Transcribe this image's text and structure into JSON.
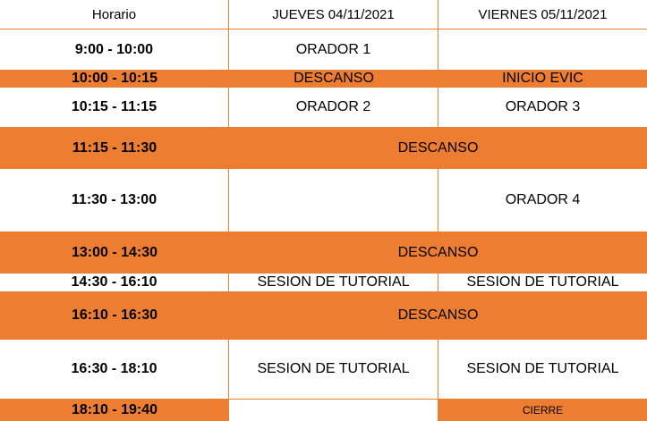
{
  "colors": {
    "accent": "#ED7D31",
    "background": "#FFFFFF",
    "text": "#000000"
  },
  "header": {
    "time_col": "Horario",
    "day1": "JUEVES 04/11/2021",
    "day2": "VIERNES  05/11/2021"
  },
  "rows": [
    {
      "time": "9:00 - 10:00",
      "day1": "ORADOR 1",
      "day2": ""
    },
    {
      "time": "10:00 - 10:15",
      "day1": "DESCANSO",
      "day2": "INICIO EVIC"
    },
    {
      "time": "10:15 - 11:15",
      "day1": "ORADOR 2",
      "day2": "ORADOR 3"
    },
    {
      "time": "11:15 - 11:30",
      "span": "DESCANSO"
    },
    {
      "time": "11:30 - 13:00",
      "day1": "",
      "day2": "ORADOR 4"
    },
    {
      "time": "13:00 - 14:30",
      "span": "DESCANSO"
    },
    {
      "time": "14:30 - 16:10",
      "day1": "SESION DE TUTORIAL",
      "day2": "SESION DE TUTORIAL"
    },
    {
      "time": "16:10 - 16:30",
      "span": "DESCANSO"
    },
    {
      "time": "16:30 - 18:10",
      "day1": "SESION DE TUTORIAL",
      "day2": "SESION DE TUTORIAL"
    },
    {
      "time": "18:10 - 19:40",
      "day1": "",
      "day2": "CIERRE"
    }
  ]
}
